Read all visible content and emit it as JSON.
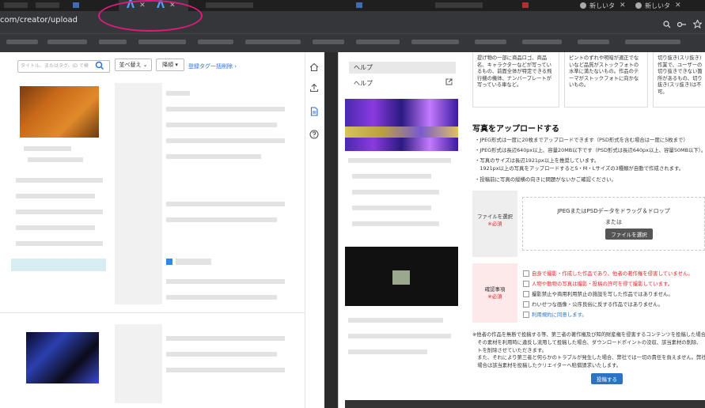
{
  "browser": {
    "tabs": [
      {
        "label": "新しいタ",
        "close": "✕"
      },
      {
        "label": "新しいタ",
        "close": "✕"
      }
    ],
    "active_tab_icon": "Λ",
    "active_tab_close": "✕",
    "url": "com/creator/upload"
  },
  "left_panel": {
    "search_placeholder": "タイトル、またはタグ、ID で検",
    "sort_label": "並べ替え ⌄",
    "order_label": "降順 ▾",
    "clear_tags_label": "登録タグ一括削除 ›"
  },
  "help_panel": {
    "header": "ヘルプ",
    "link": "ヘルプ"
  },
  "cards": [
    {
      "text": "提げ物の一部に商品ロゴ、商品名、キャラクターなどが写っているもの、前面全体が特定できる飛行機の機体、ナンバープレートが写っている車など。"
    },
    {
      "text": "ピントのずれや明暗が適正でないなど品質がストックフォトの水準に満たないもの。作品のテーマがストックフォトに向かないもの。"
    },
    {
      "text": "切り抜き(スリ抜き)作業で、ユーザーの切り抜きできない箇所があるもの、切り抜き(スリ抜き)は不可。"
    }
  ],
  "upload": {
    "heading": "写真をアップロードする",
    "bullets": [
      "・JPEG形式は一度に20枚までアップロードできます（PSD形式を含む場合は一度に5枚まで）",
      "・JPEG形式は長辺640px以上、容量20MB以下です（PSD形式は長辺640px以上、容量50MB以下）。",
      "・写真のサイズは長辺1921px以上を推奨しています。",
      "　1921px以上の写真をアップロードするとS・M・Lサイズの3種類が自動で作成されます。",
      "・投稿前に写真の縦横の向きに問題がないかご確認ください。"
    ],
    "file_label": "ファイルを選択",
    "required": "※必須",
    "drop_text": "JPEGまたはPSDデータをドラッグ＆ドロップ",
    "or_text": "または",
    "file_button": "ファイルを選択",
    "confirm_label": "確認事項",
    "checks": [
      "自身で撮影・作成した作品であり、他者の著作権を侵害していません。",
      "人物や動物の写真は撮影・投稿の許可を得て撮影しています。",
      "撮影禁止や商用利用禁止の施設を写した作品ではありません。",
      "わいせつな画像・公序良俗に反する作品ではありません。",
      "利用規約に同意します。"
    ],
    "notes": [
      "※他者の作品を無断で投稿する等、第三者の著作権及び知的財産権を侵害するコンテンツを投稿した場合",
      "　その素材を利用時に違反し流用して投稿した場合、ダウンロードポイントの没収、該当素材の削除、",
      "　トを削除させていただきます。",
      "　また、それにより第三者と何らかのトラブルが発生した場合、弊社では一切の責任を負えません。弊社",
      "　場合は該当素材を投稿したクリエイターへ賠償請求いたします。"
    ],
    "submit": "投稿する"
  },
  "colors": {
    "accent_blue": "#2b74c5",
    "required_red": "#e0282f",
    "annotation_pink": "#e0197d"
  }
}
